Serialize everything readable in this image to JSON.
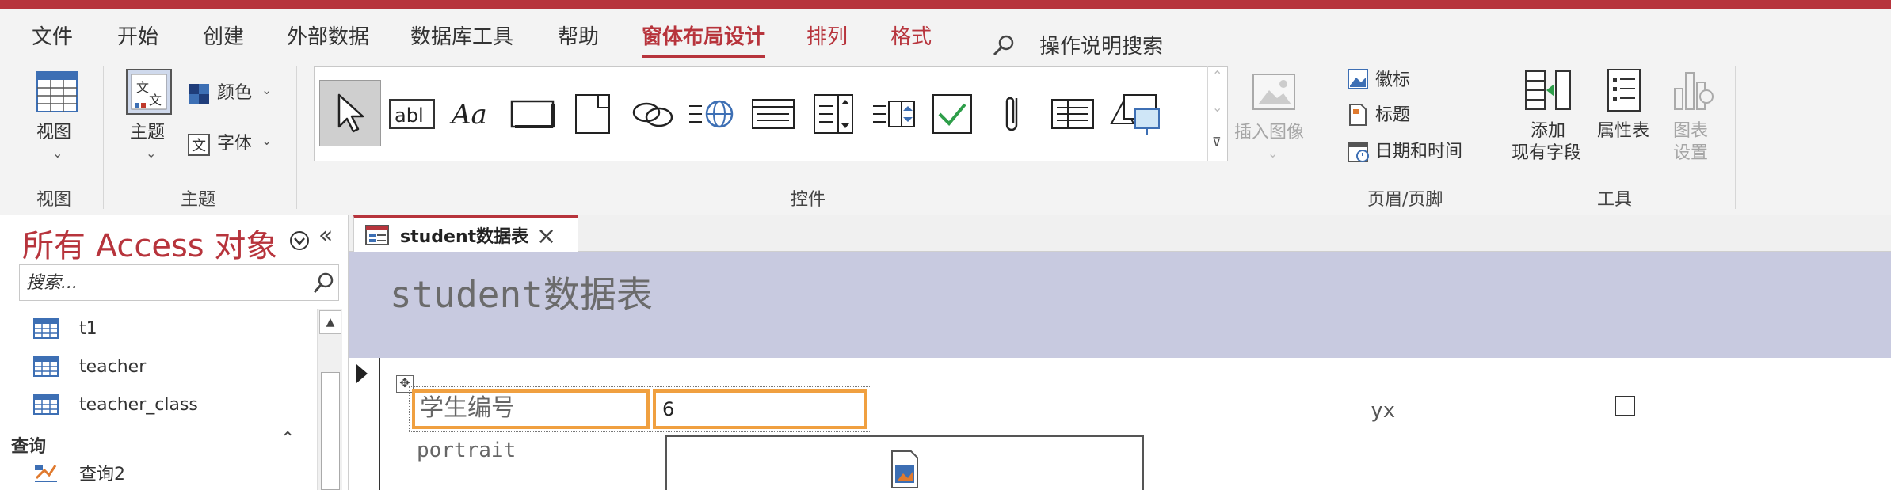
{
  "menu": {
    "tabs": [
      {
        "label": "文件"
      },
      {
        "label": "开始"
      },
      {
        "label": "创建"
      },
      {
        "label": "外部数据"
      },
      {
        "label": "数据库工具"
      },
      {
        "label": "帮助"
      },
      {
        "label": "窗体布局设计",
        "active": true
      },
      {
        "label": "排列"
      },
      {
        "label": "格式"
      }
    ],
    "search_label": "操作说明搜索"
  },
  "ribbon": {
    "view": {
      "button_label": "视图",
      "group_label": "视图"
    },
    "theme": {
      "button_label": "主题",
      "colors_label": "颜色",
      "fonts_label": "字体",
      "group_label": "主题"
    },
    "controls": {
      "group_label": "控件",
      "items": [
        "select-tool",
        "text-box",
        "label",
        "button",
        "tab-control",
        "hyperlink",
        "web-browser-control",
        "navigation-control",
        "option-group",
        "combo-box",
        "check-box",
        "attachment",
        "list-box",
        "chart"
      ],
      "insert_image_label": "插入图像"
    },
    "header_footer": {
      "logo_label": "徽标",
      "title_label": "标题",
      "datetime_label": "日期和时间",
      "group_label": "页眉/页脚"
    },
    "tools": {
      "add_fields_label_1": "添加",
      "add_fields_label_2": "现有字段",
      "property_sheet_label": "属性表",
      "chart_settings_label_1": "图表",
      "chart_settings_label_2": "设置",
      "group_label": "工具"
    }
  },
  "nav": {
    "title": "所有 Access 对象",
    "search_placeholder": "搜索...",
    "items": [
      {
        "label": "t1",
        "icon": "table-icon"
      },
      {
        "label": "teacher",
        "icon": "table-icon"
      },
      {
        "label": "teacher_class",
        "icon": "table-icon"
      }
    ],
    "section_label": "查询",
    "queries": [
      {
        "label": "查询2",
        "icon": "query-icon"
      }
    ]
  },
  "document": {
    "tab_label": "student数据表",
    "form_title": "student数据表",
    "field_label": "学生编号",
    "field_value": "6",
    "portrait_label": "portrait",
    "extra_label": "yx",
    "checkbox_checked": false
  },
  "colors": {
    "accent": "#b7343c",
    "form_header": "#c8cae0",
    "selection": "#f0a040"
  }
}
